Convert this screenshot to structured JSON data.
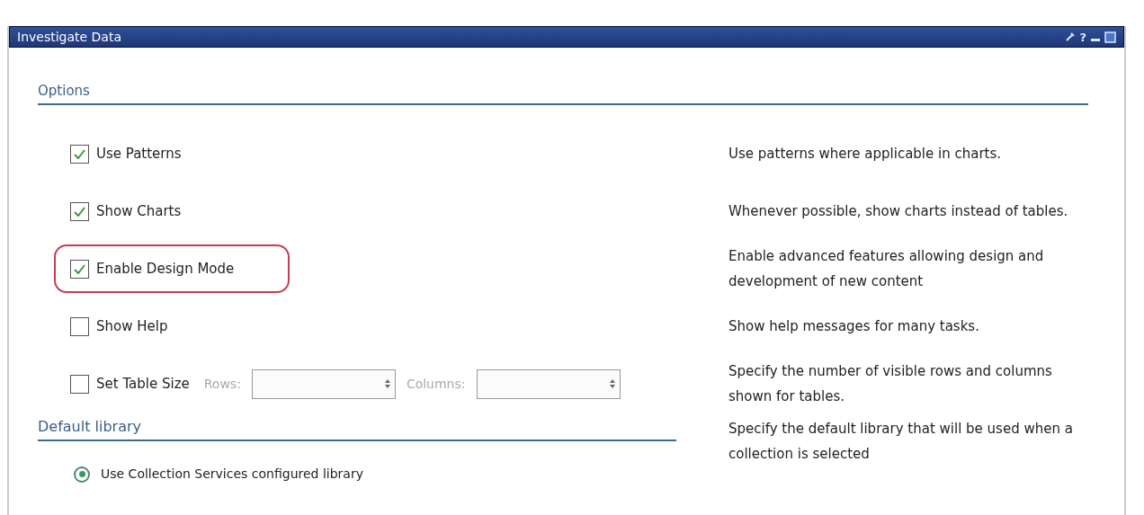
{
  "window": {
    "title": "Investigate Data",
    "help_label": "?"
  },
  "options": {
    "heading": "Options",
    "rows": [
      {
        "kind": "checkbox",
        "label": "Use Patterns",
        "checked": true,
        "highlighted": false,
        "description": "Use patterns where applicable in charts."
      },
      {
        "kind": "checkbox",
        "label": "Show Charts",
        "checked": true,
        "highlighted": false,
        "description": "Whenever possible, show charts instead of tables."
      },
      {
        "kind": "checkbox",
        "label": "Enable Design Mode",
        "checked": true,
        "highlighted": true,
        "description": "Enable advanced features allowing design and development of new content"
      },
      {
        "kind": "checkbox",
        "label": "Show Help",
        "checked": false,
        "highlighted": false,
        "description": "Show help messages for many tasks."
      },
      {
        "kind": "table_size",
        "label": "Set Table Size",
        "checked": false,
        "highlighted": false,
        "rows_label": "Rows:",
        "columns_label": "Columns:",
        "description": "Specify the number of visible rows and columns shown for tables."
      }
    ]
  },
  "default_library": {
    "heading": "Default library",
    "description": "Specify the default library that will be used when a collection is selected",
    "choices": [
      {
        "label": "Use Collection Services configured library",
        "selected": true
      }
    ]
  }
}
